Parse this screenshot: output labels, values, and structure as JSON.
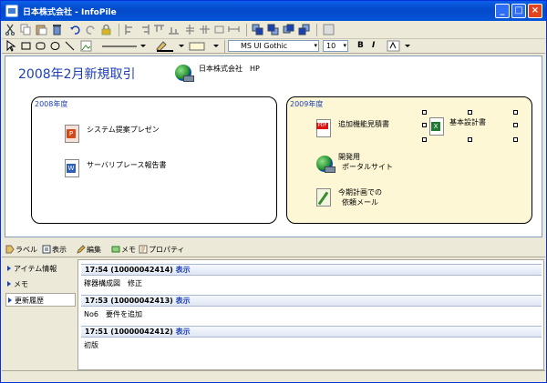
{
  "window": {
    "title": "日本株式会社 - InfoPile"
  },
  "canvas": {
    "page_title": "2008年2月新規取引",
    "company_link": "日本株式会社　HP",
    "group2008": {
      "label": "2008年度",
      "items": [
        "システム提案プレゼン",
        "サーバリプレース報告書"
      ]
    },
    "group2009": {
      "label": "2009年度",
      "items": [
        "追加機能見積書",
        "開発用",
        "ポータルサイト",
        "今期計画での",
        "依頼メール",
        "基本設計書"
      ]
    }
  },
  "format": {
    "font": "MS UI Gothic",
    "size": "10",
    "bold": "B",
    "italic": "I"
  },
  "panel_toolbar": {
    "label": "ラベル",
    "view": "表示",
    "edit": "編集",
    "memo": "メモ",
    "props": "プロパティ"
  },
  "nav": {
    "items": [
      "アイテム情報",
      "メモ",
      "更新履歴"
    ]
  },
  "history": [
    {
      "header": "17:54 (10000042414)",
      "link": "表示",
      "text": "稼器構成図　修正"
    },
    {
      "header": "17:53 (10000042413)",
      "link": "表示",
      "text": "No6　要件を追加"
    },
    {
      "header": "17:51 (10000042412)",
      "link": "表示",
      "text": "初版"
    }
  ],
  "colors": {
    "title_bar": "#0549c9",
    "accent": "#1c3fb8",
    "group2009_fill": "#fdf7d5"
  }
}
